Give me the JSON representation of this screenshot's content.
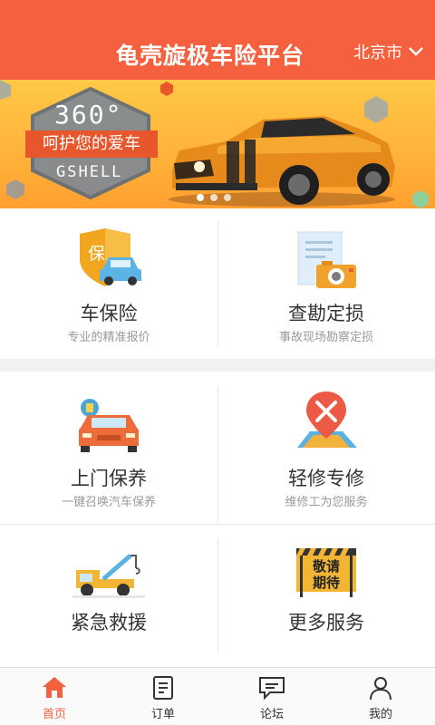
{
  "header": {
    "title": "龟壳旋极车险平台",
    "city": "北京市",
    "background_color": "#f5603f"
  },
  "banner": {
    "badge_number": "360°",
    "badge_slogan": "呵护您的爱车",
    "badge_brand": "GSHELL",
    "dot_count": 3,
    "active_dot": 0
  },
  "services_top": [
    {
      "label": "车保险",
      "desc": "专业的精准报价",
      "icon": "shield-car-icon"
    },
    {
      "label": "查勘定损",
      "desc": "事故现场勘察定损",
      "icon": "document-camera-icon"
    }
  ],
  "services_bottom": [
    {
      "label": "上门保养",
      "desc": "一键召唤汽车保养",
      "icon": "car-oil-icon"
    },
    {
      "label": "轻修专修",
      "desc": "维修工为您服务",
      "icon": "repair-pin-icon"
    },
    {
      "label": "紧急救援",
      "desc": "",
      "icon": "tow-truck-icon"
    },
    {
      "label": "更多服务",
      "desc": "",
      "icon": "coming-soon-sign-icon"
    }
  ],
  "more_sign_text": [
    "敬请",
    "期待"
  ],
  "tabs": [
    {
      "label": "首页",
      "icon": "home-icon",
      "active": true
    },
    {
      "label": "订单",
      "icon": "order-icon",
      "active": false
    },
    {
      "label": "论坛",
      "icon": "forum-icon",
      "active": false
    },
    {
      "label": "我的",
      "icon": "profile-icon",
      "active": false
    }
  ],
  "colors": {
    "accent": "#f5603f",
    "banner_yellow": "#ffb23a",
    "text_primary": "#333333",
    "text_secondary": "#9a9a9a"
  }
}
